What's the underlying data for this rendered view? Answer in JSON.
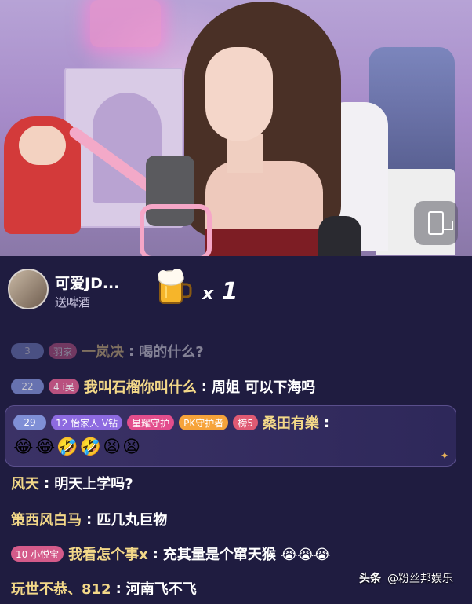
{
  "stream": {
    "rotate_button_icon": "screen-rotate-icon"
  },
  "gift_banner": {
    "sender": "可爱JD...",
    "action": "送啤酒",
    "gift_icon": "beer-mug-icon",
    "count": "1",
    "count_prefix": "x"
  },
  "chat": {
    "messages": [
      {
        "badges": [
          "3",
          "羽家"
        ],
        "user": "一岚决",
        "text": "喝的什么?",
        "faded": true
      },
      {
        "badges": [
          "22",
          "4 i吴"
        ],
        "user": "我叫石榴你叫什么",
        "text": "周姐 可以下海吗",
        "faded": false
      },
      {
        "user": "风天",
        "text": "明天上学吗?"
      },
      {
        "user": "策西风白马",
        "text": "匹几丸巨物"
      },
      {
        "badges": [
          "10 小悦宝"
        ],
        "user": "我看怎个事x",
        "text": "充其量是个窜天猴 😭😭😭"
      },
      {
        "user": "玩世不恭、812",
        "text": "河南飞不飞"
      }
    ],
    "vip_message": {
      "level": "29",
      "family": "12 怡家人 V钻",
      "guard": "星耀守护",
      "pk": "PK守护者",
      "rank": "榜5",
      "user": "桑田有樂",
      "emojis": "😂😂🤣🤣😫😫"
    }
  },
  "watermark": {
    "logo": "头条",
    "account": "@粉丝邦娱乐"
  },
  "colors": {
    "chat_bg": "#1f1c40",
    "username": "#f3d888",
    "fan_badge": "#d45b8a"
  }
}
